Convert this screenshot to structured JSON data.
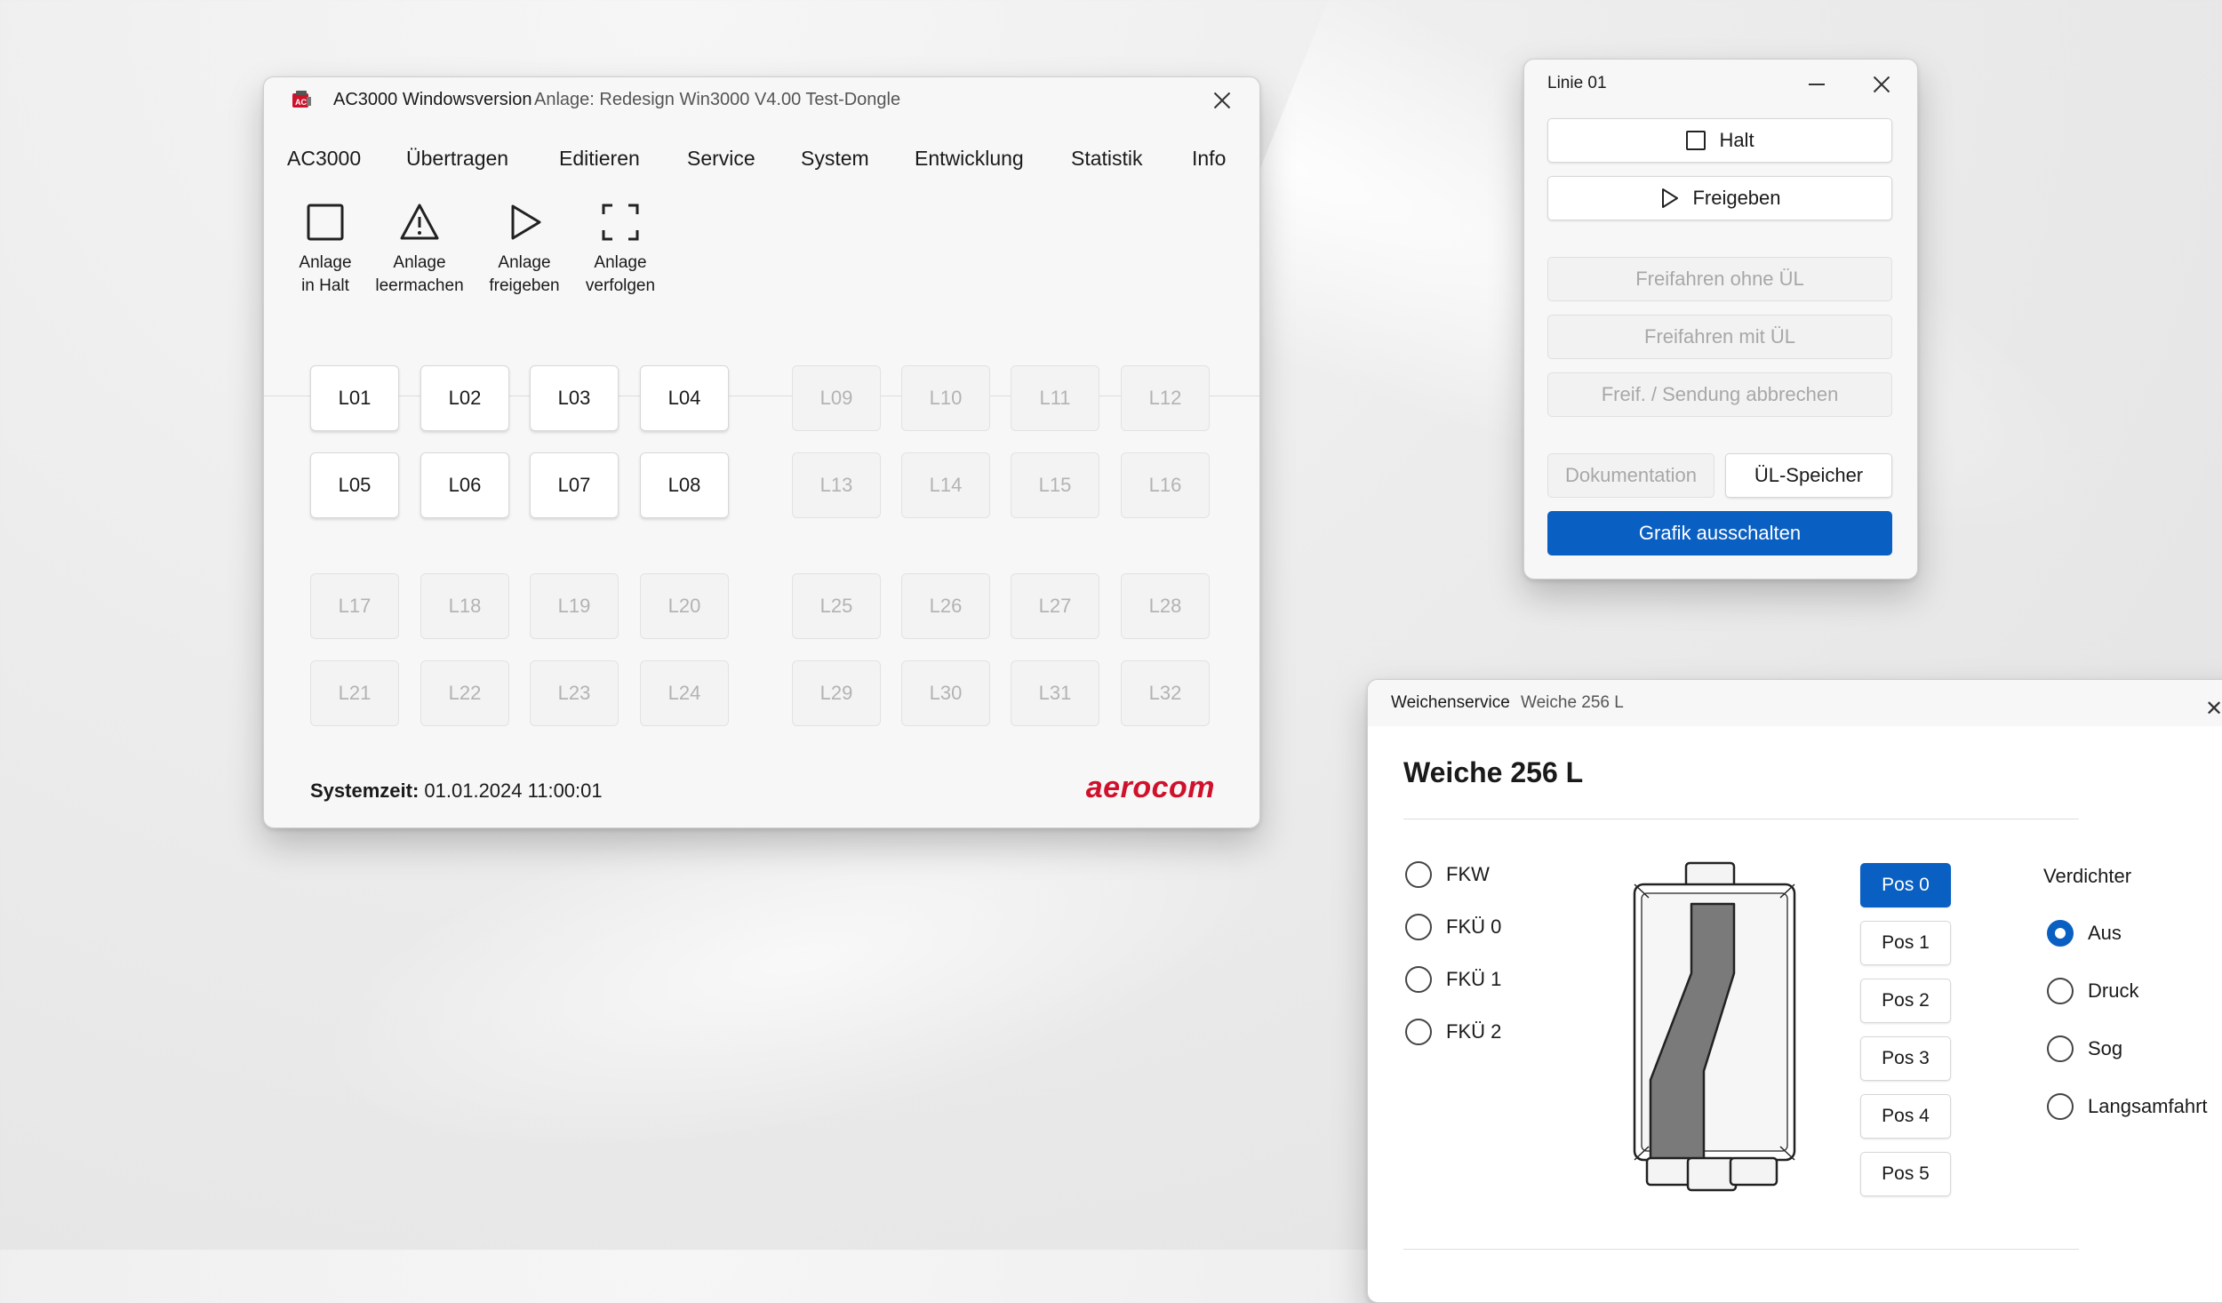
{
  "main_window": {
    "title": "AC3000 Windowsversion",
    "subtitle": "Anlage: Redesign Win3000 V4.00 Test-Dongle",
    "menu": [
      "AC3000",
      "Übertragen",
      "Editieren",
      "Service",
      "System",
      "Entwicklung",
      "Statistik",
      "Info"
    ],
    "tools": [
      {
        "icon": "square-icon",
        "label1": "Anlage",
        "label2": "in Halt"
      },
      {
        "icon": "warning-icon",
        "label1": "Anlage",
        "label2": "leermachen"
      },
      {
        "icon": "play-icon",
        "label1": "Anlage",
        "label2": "freigeben"
      },
      {
        "icon": "focus-frame-icon",
        "label1": "Anlage",
        "label2": "verfolgen"
      }
    ],
    "lines": [
      {
        "label": "L01",
        "enabled": true
      },
      {
        "label": "L02",
        "enabled": true
      },
      {
        "label": "L03",
        "enabled": true
      },
      {
        "label": "L04",
        "enabled": true
      },
      {
        "label": "L09",
        "enabled": false
      },
      {
        "label": "L10",
        "enabled": false
      },
      {
        "label": "L11",
        "enabled": false
      },
      {
        "label": "L12",
        "enabled": false
      },
      {
        "label": "L05",
        "enabled": true
      },
      {
        "label": "L06",
        "enabled": true
      },
      {
        "label": "L07",
        "enabled": true
      },
      {
        "label": "L08",
        "enabled": true
      },
      {
        "label": "L13",
        "enabled": false
      },
      {
        "label": "L14",
        "enabled": false
      },
      {
        "label": "L15",
        "enabled": false
      },
      {
        "label": "L16",
        "enabled": false
      },
      {
        "label": "L17",
        "enabled": false
      },
      {
        "label": "L18",
        "enabled": false
      },
      {
        "label": "L19",
        "enabled": false
      },
      {
        "label": "L20",
        "enabled": false
      },
      {
        "label": "L25",
        "enabled": false
      },
      {
        "label": "L26",
        "enabled": false
      },
      {
        "label": "L27",
        "enabled": false
      },
      {
        "label": "L28",
        "enabled": false
      },
      {
        "label": "L21",
        "enabled": false
      },
      {
        "label": "L22",
        "enabled": false
      },
      {
        "label": "L23",
        "enabled": false
      },
      {
        "label": "L24",
        "enabled": false
      },
      {
        "label": "L29",
        "enabled": false
      },
      {
        "label": "L30",
        "enabled": false
      },
      {
        "label": "L31",
        "enabled": false
      },
      {
        "label": "L32",
        "enabled": false
      }
    ],
    "systemzeit_label": "Systemzeit:",
    "systemzeit_value": "01.01.2024 11:00:01",
    "brand": "aerocom",
    "brand_color": "#d0112b"
  },
  "linie_window": {
    "title": "Linie 01",
    "halt": "Halt",
    "freigeben": "Freigeben",
    "freifahren_ohne": "Freifahren ohne ÜL",
    "freifahren_mit": "Freifahren mit ÜL",
    "freif_abbrechen": "Freif. / Sendung abbrechen",
    "dokumentation": "Dokumentation",
    "ul_speicher": "ÜL-Speicher",
    "grafik": "Grafik ausschalten",
    "accent": "#0a5fc2"
  },
  "weichen_window": {
    "title": "Weichenservice",
    "subtitle": "Weiche 256 L",
    "heading": "Weiche 256 L",
    "modes": [
      "FKW",
      "FKÜ 0",
      "FKÜ 1",
      "FKÜ 2"
    ],
    "positions": [
      "Pos 0",
      "Pos 1",
      "Pos 2",
      "Pos 3",
      "Pos 4",
      "Pos 5"
    ],
    "active_position": "Pos 0",
    "verdichter_label": "Verdichter",
    "verdichter": [
      "Aus",
      "Druck",
      "Sog",
      "Langsamfahrt"
    ],
    "verdichter_selected": "Aus"
  }
}
